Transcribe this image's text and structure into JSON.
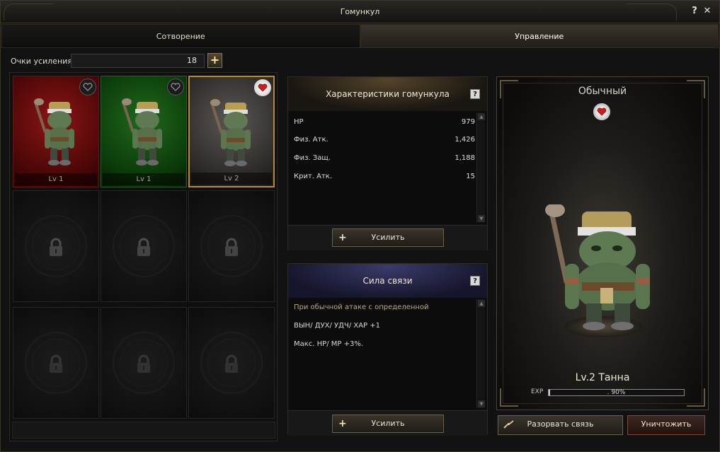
{
  "window": {
    "title": "Гомункул",
    "help_label": "?",
    "close_label": "✕"
  },
  "tabs": [
    {
      "label": "Сотворение",
      "active": false
    },
    {
      "label": "Управление",
      "active": true
    }
  ],
  "points": {
    "label": "Очки усиления",
    "value": "18",
    "add_label": "+"
  },
  "slots": [
    {
      "level": "Lv 1",
      "color": "red",
      "favorite": false
    },
    {
      "level": "Lv 1",
      "color": "green",
      "favorite": false
    },
    {
      "level": "Lv 2",
      "color": "grey",
      "favorite": true
    }
  ],
  "stats_panel": {
    "title": "Характеристики гомункула",
    "help": "?",
    "rows": [
      {
        "label": "HP",
        "value": "979"
      },
      {
        "label": "Физ. Атк.",
        "value": "1,426"
      },
      {
        "label": "Физ. Защ.",
        "value": "1,188"
      },
      {
        "label": "Крит. Атк.",
        "value": "15"
      }
    ],
    "button_label": "Усилить",
    "button_icon": "+"
  },
  "bond_panel": {
    "title": "Сила связи",
    "help": "?",
    "lines": [
      "При обычной атаке с определенной",
      "ВЫН/ ДУХ/ УДЧ/ ХАР +1",
      "Макс. HP/ MP +3%."
    ],
    "button_label": "Усилить",
    "button_icon": "+"
  },
  "showcase": {
    "rank": "Обычный",
    "name": "Lv.2 Танна",
    "exp_label": "EXP",
    "exp_text": ". 90%",
    "exp_fraction": 0.009
  },
  "actions": {
    "break_label": "Разорвать связь",
    "destroy_label": "Уничтожить"
  },
  "colors": {
    "accent_gold": "#b58a3a",
    "heart_red": "#d61a1a",
    "slot_red": "#8d1515",
    "slot_green": "#1f6a1c"
  }
}
